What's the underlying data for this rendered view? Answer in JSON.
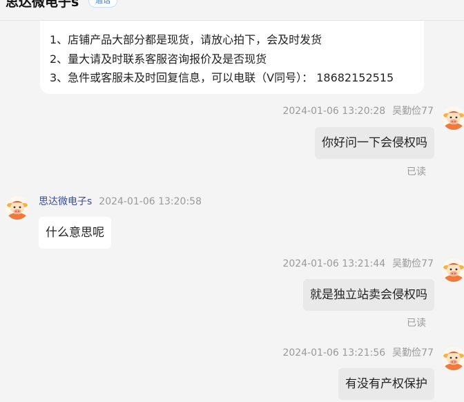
{
  "header": {
    "title": "思达微电子s",
    "badge": "通话"
  },
  "notice": {
    "lines": [
      "1、店铺产品大部分都是现货，请放心拍下，会及时发货",
      "2、量大请及时联系客服咨询报价及是否现货",
      "3、急件或客服未及时回复信息，可以电联（V同号）： 18682152515"
    ]
  },
  "messages": [
    {
      "side": "right",
      "sender": "吴勤俭77",
      "time": "2024-01-06 13:20:28",
      "text": "你好问一下会侵权吗",
      "status": "已读"
    },
    {
      "side": "left",
      "sender": "思达微电子s",
      "time": "2024-01-06 13:20:58",
      "text": "什么意思呢",
      "status": ""
    },
    {
      "side": "right",
      "sender": "吴勤俭77",
      "time": "2024-01-06 13:21:44",
      "text": "就是独立站卖会侵权吗",
      "status": "已读"
    },
    {
      "side": "right",
      "sender": "吴勤俭77",
      "time": "2024-01-06 13:21:56",
      "text": "有没有产权保护",
      "status": ""
    }
  ],
  "colors": {
    "background": "#f4f4f4",
    "own_bubble": "#e9e9e9",
    "other_bubble": "#ffffff",
    "shop_name": "#3a4a9a",
    "meta_text": "#999999"
  },
  "icons": {
    "user_avatar": "cow-cartoon-icon",
    "shop_avatar": "cow-cartoon-icon"
  }
}
